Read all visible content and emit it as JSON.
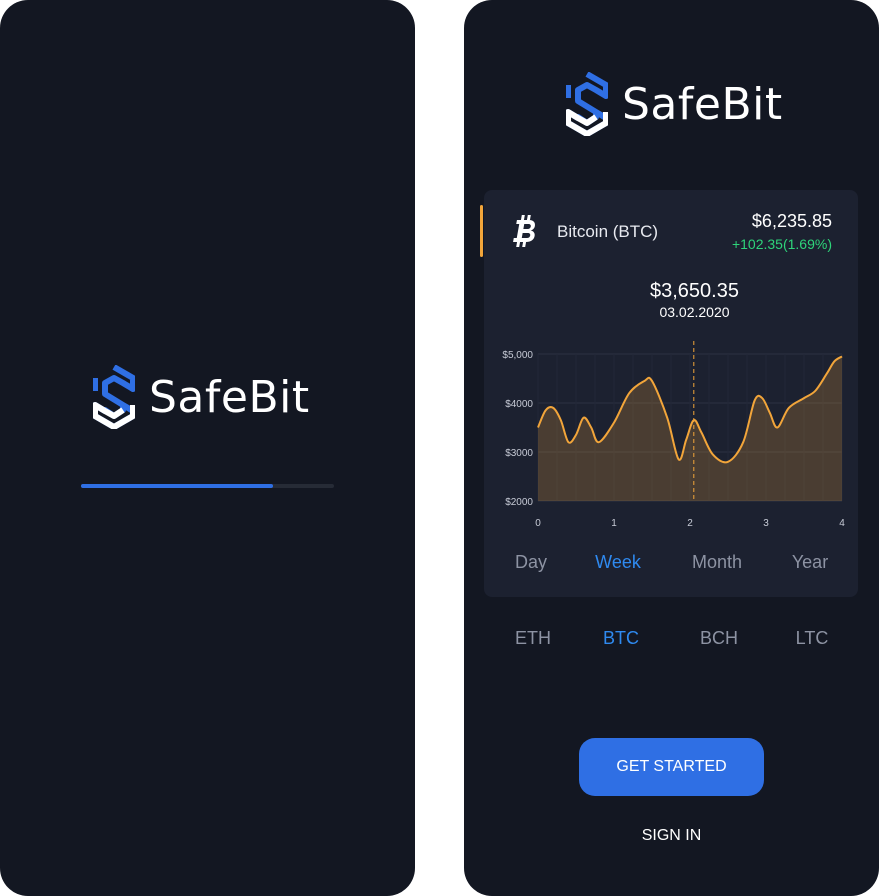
{
  "app": {
    "name": "SafeBit",
    "brand_color": "#2f6fe4",
    "accent_color": "#f2a53a"
  },
  "splash": {
    "loading_progress": 0.76
  },
  "home": {
    "coin": {
      "icon": "bitcoin-icon",
      "name": "Bitcoin (BTC)",
      "price": "$6,235.85",
      "change": "+102.35(1.69%)"
    },
    "tooltip": {
      "price": "$3,650.35",
      "date": "03.02.2020",
      "x": 2.05
    },
    "periods": [
      "Day",
      "Week",
      "Month",
      "Year"
    ],
    "active_period": "Week",
    "coins": [
      "ETH",
      "BTC",
      "BCH",
      "LTC"
    ],
    "active_coin": "BTC",
    "cta_label": "GET STARTED",
    "signin_label": "SIGN IN"
  },
  "chart_data": {
    "type": "area",
    "x": [
      0,
      0.1,
      0.2,
      0.3,
      0.4,
      0.5,
      0.6,
      0.7,
      0.8,
      1.0,
      1.2,
      1.4,
      1.5,
      1.7,
      1.85,
      1.95,
      2.05,
      2.15,
      2.3,
      2.5,
      2.7,
      2.85,
      2.95,
      3.05,
      3.15,
      3.3,
      3.5,
      3.65,
      3.8,
      3.9,
      4.0
    ],
    "y": [
      3500,
      3850,
      3900,
      3650,
      3200,
      3350,
      3700,
      3500,
      3200,
      3600,
      4200,
      4450,
      4450,
      3700,
      2850,
      3250,
      3650,
      3400,
      2950,
      2800,
      3200,
      4050,
      4100,
      3800,
      3500,
      3900,
      4100,
      4250,
      4600,
      4850,
      4950
    ],
    "xlim": [
      0,
      4
    ],
    "ylim": [
      2000,
      5000
    ],
    "xticks": [
      "0",
      "1",
      "2",
      "3",
      "4"
    ],
    "yticks": [
      "$2000",
      "$3000",
      "$4000",
      "$5,000"
    ],
    "grid": true
  }
}
